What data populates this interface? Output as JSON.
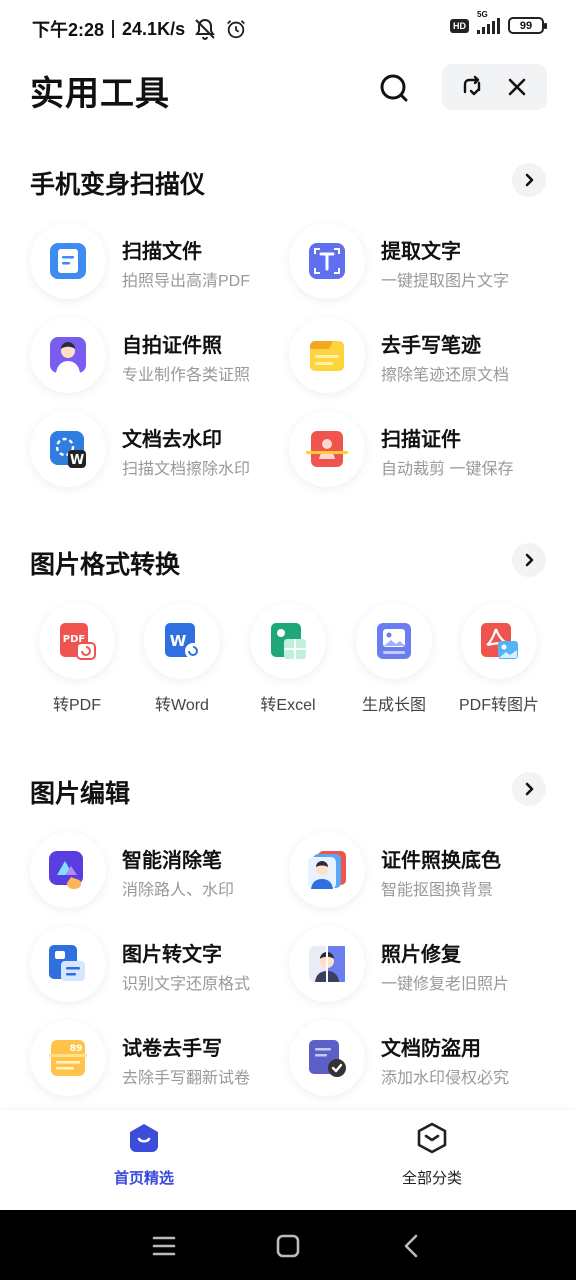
{
  "status_bar": {
    "time": "下午2:28",
    "speed": "24.1K/s",
    "hd": "HD",
    "network": "5G",
    "battery": "99"
  },
  "header": {
    "title": "实用工具"
  },
  "scanner": {
    "title": "手机变身扫描仪",
    "items": [
      {
        "name": "扫描文件",
        "desc": "拍照导出高清PDF",
        "icon": "scan-document-icon"
      },
      {
        "name": "提取文字",
        "desc": "一键提取图片文字",
        "icon": "extract-text-icon"
      },
      {
        "name": "自拍证件照",
        "desc": "专业制作各类证照",
        "icon": "id-photo-icon"
      },
      {
        "name": "去手写笔迹",
        "desc": "擦除笔迹还原文档",
        "icon": "remove-handwriting-icon"
      },
      {
        "name": "文档去水印",
        "desc": "扫描文档擦除水印",
        "icon": "remove-watermark-icon"
      },
      {
        "name": "扫描证件",
        "desc": "自动裁剪 一键保存",
        "icon": "scan-id-icon"
      }
    ]
  },
  "format": {
    "title": "图片格式转换",
    "items": [
      {
        "label": "转PDF",
        "icon": "to-pdf-icon"
      },
      {
        "label": "转Word",
        "icon": "to-word-icon"
      },
      {
        "label": "转Excel",
        "icon": "to-excel-icon"
      },
      {
        "label": "生成长图",
        "icon": "long-image-icon"
      },
      {
        "label": "PDF转图片",
        "icon": "pdf-to-image-icon"
      }
    ]
  },
  "edit": {
    "title": "图片编辑",
    "items": [
      {
        "name": "智能消除笔",
        "desc": "消除路人、水印",
        "icon": "smart-eraser-icon"
      },
      {
        "name": "证件照换底色",
        "desc": "智能抠图换背景",
        "icon": "change-background-icon"
      },
      {
        "name": "图片转文字",
        "desc": "识别文字还原格式",
        "icon": "image-to-text-icon"
      },
      {
        "name": "照片修复",
        "desc": "一键修复老旧照片",
        "icon": "photo-repair-icon"
      },
      {
        "name": "试卷去手写",
        "desc": "去除手写翻新试卷",
        "icon": "exam-clean-icon"
      },
      {
        "name": "文档防盗用",
        "desc": "添加水印侵权必究",
        "icon": "doc-protect-icon"
      }
    ]
  },
  "tabs": {
    "home": "首页精选",
    "categories": "全部分类"
  },
  "colors": {
    "accent": "#3b4bdc",
    "subtext": "#999999"
  }
}
